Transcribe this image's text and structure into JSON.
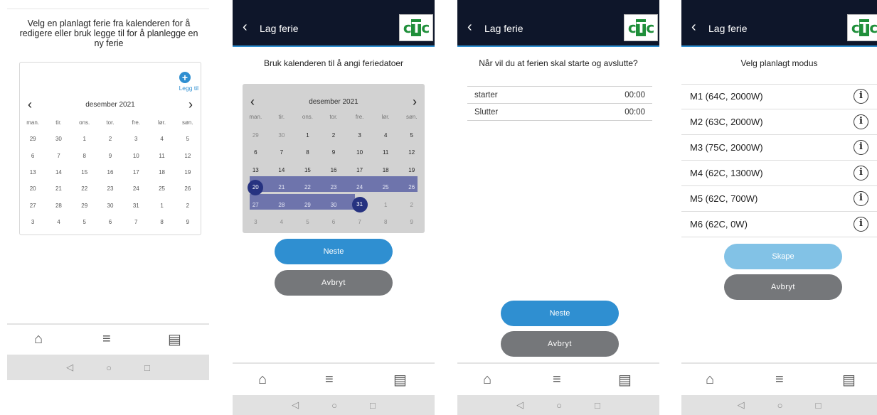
{
  "screen1": {
    "instruction": "Velg en planlagt ferie fra kalenderen for å redigere eller bruk legge til for å planlegge en ny ferie",
    "add_label": "Legg til",
    "month": "desember 2021",
    "weekdays": [
      "man.",
      "tir.",
      "ons.",
      "tor.",
      "fre.",
      "lør.",
      "søn."
    ],
    "weeks": [
      [
        "29",
        "30",
        "1",
        "2",
        "3",
        "4",
        "5"
      ],
      [
        "6",
        "7",
        "8",
        "9",
        "10",
        "11",
        "12"
      ],
      [
        "13",
        "14",
        "15",
        "16",
        "17",
        "18",
        "19"
      ],
      [
        "20",
        "21",
        "22",
        "23",
        "24",
        "25",
        "26"
      ],
      [
        "27",
        "28",
        "29",
        "30",
        "31",
        "1",
        "2"
      ],
      [
        "3",
        "4",
        "5",
        "6",
        "7",
        "8",
        "9"
      ]
    ]
  },
  "screen2": {
    "header_title": "Lag ferie",
    "subtitle": "Bruk kalenderen til å angi feriedatoer",
    "month": "desember 2021",
    "next_button": "Neste",
    "cancel_button": "Avbryt"
  },
  "screen3": {
    "header_title": "Lag ferie",
    "subtitle": "Når vil du at ferien skal starte og avslutte?",
    "rows": [
      {
        "label": "starter",
        "value": "00:00"
      },
      {
        "label": "Slutter",
        "value": "00:00"
      }
    ],
    "next_button": "Neste",
    "cancel_button": "Avbryt"
  },
  "screen4": {
    "header_title": "Lag ferie",
    "subtitle": "Velg planlagt modus",
    "modes": [
      "M1 (64C, 2000W)",
      "M2 (63C, 2000W)",
      "M3 (75C, 2000W)",
      "M4 (62C, 1300W)",
      "M5 (62C, 700W)",
      "M6 (62C, 0W)"
    ],
    "create_button": "Skape",
    "cancel_button": "Avbryt"
  },
  "logo": {
    "c1": "c",
    "t": "T",
    "c2": "c"
  },
  "icons": {
    "back": "chevron-left-icon",
    "home": "home-icon",
    "menu": "menu-icon",
    "calendar": "calendar-clock-icon",
    "info": "info-icon"
  },
  "colors": {
    "header_bg": "#0e162a",
    "accent": "#2f8fd1",
    "range": "#6e74ac",
    "range_end": "#263280",
    "cancel": "#75777a",
    "logo_green": "#1f8f3a"
  }
}
